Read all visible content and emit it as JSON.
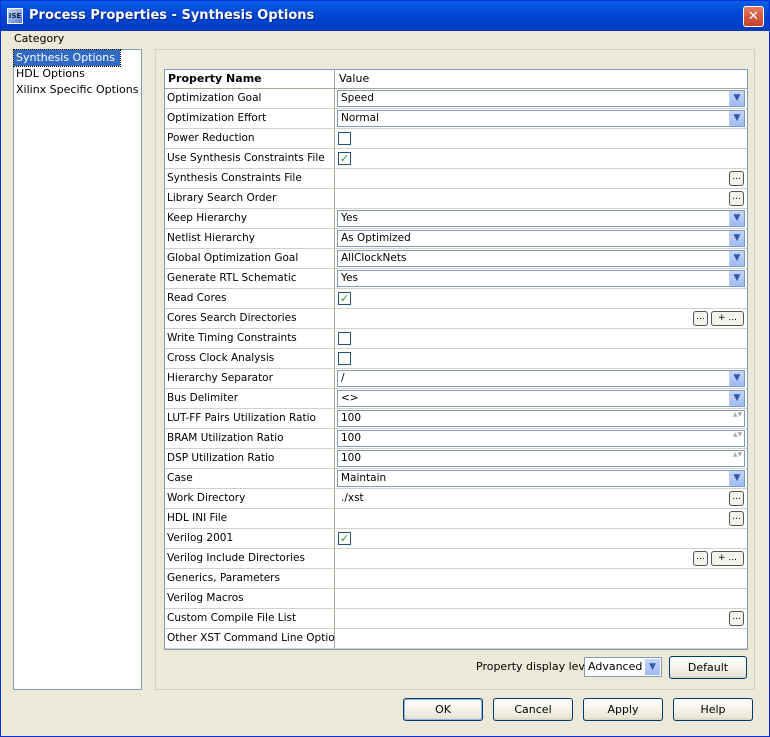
{
  "window": {
    "title": "Process Properties - Synthesis Options",
    "close_glyph": "✕",
    "icon_text": "ISE"
  },
  "category": {
    "label": "Category",
    "items": [
      {
        "label": "Synthesis Options",
        "selected": true
      },
      {
        "label": "HDL Options",
        "selected": false
      },
      {
        "label": "Xilinx Specific Options",
        "selected": false
      }
    ]
  },
  "grid": {
    "col_name": "Property Name",
    "col_value": "Value",
    "rows": [
      {
        "name": "Optimization Goal",
        "type": "combo",
        "value": "Speed"
      },
      {
        "name": "Optimization Effort",
        "type": "combo",
        "value": "Normal"
      },
      {
        "name": "Power Reduction",
        "type": "check",
        "value": ""
      },
      {
        "name": "Use Synthesis Constraints File",
        "type": "check",
        "value": "✓"
      },
      {
        "name": "Synthesis Constraints File",
        "type": "ellipsis",
        "value": ""
      },
      {
        "name": "Library Search Order",
        "type": "ellipsis",
        "value": ""
      },
      {
        "name": "Keep Hierarchy",
        "type": "combo",
        "value": "Yes"
      },
      {
        "name": "Netlist Hierarchy",
        "type": "combo",
        "value": "As Optimized"
      },
      {
        "name": "Global Optimization Goal",
        "type": "combo",
        "value": "AllClockNets"
      },
      {
        "name": "Generate RTL Schematic",
        "type": "combo",
        "value": "Yes"
      },
      {
        "name": "Read Cores",
        "type": "check",
        "value": "✓"
      },
      {
        "name": "Cores Search Directories",
        "type": "list",
        "value": ""
      },
      {
        "name": "Write Timing Constraints",
        "type": "check",
        "value": ""
      },
      {
        "name": "Cross Clock Analysis",
        "type": "check",
        "value": ""
      },
      {
        "name": "Hierarchy Separator",
        "type": "combo",
        "value": "/"
      },
      {
        "name": "Bus Delimiter",
        "type": "combo",
        "value": "<>"
      },
      {
        "name": "LUT-FF Pairs Utilization Ratio",
        "type": "spin",
        "value": "100"
      },
      {
        "name": "BRAM Utilization Ratio",
        "type": "spin",
        "value": "100"
      },
      {
        "name": "DSP Utilization Ratio",
        "type": "spin",
        "value": "100"
      },
      {
        "name": "Case",
        "type": "combo",
        "value": "Maintain"
      },
      {
        "name": "Work Directory",
        "type": "ellipsis",
        "value": "./xst"
      },
      {
        "name": "HDL INI File",
        "type": "ellipsis",
        "value": ""
      },
      {
        "name": "Verilog 2001",
        "type": "check",
        "value": "✓"
      },
      {
        "name": "Verilog Include Directories",
        "type": "list",
        "value": ""
      },
      {
        "name": "Generics, Parameters",
        "type": "text",
        "value": ""
      },
      {
        "name": "Verilog Macros",
        "type": "text",
        "value": ""
      },
      {
        "name": "Custom Compile File List",
        "type": "ellipsis",
        "value": ""
      },
      {
        "name": "Other XST Command Line Options",
        "type": "text",
        "value": ""
      }
    ],
    "ellipsis_glyph": "...",
    "plus_glyph": "+ ...",
    "arrow_glyph": "▼",
    "spin_glyph": "▲▼"
  },
  "display_level": {
    "label": "Property display level:",
    "value": "Advanced"
  },
  "buttons": {
    "default": "Default",
    "ok": "OK",
    "cancel": "Cancel",
    "apply": "Apply",
    "help": "Help"
  }
}
